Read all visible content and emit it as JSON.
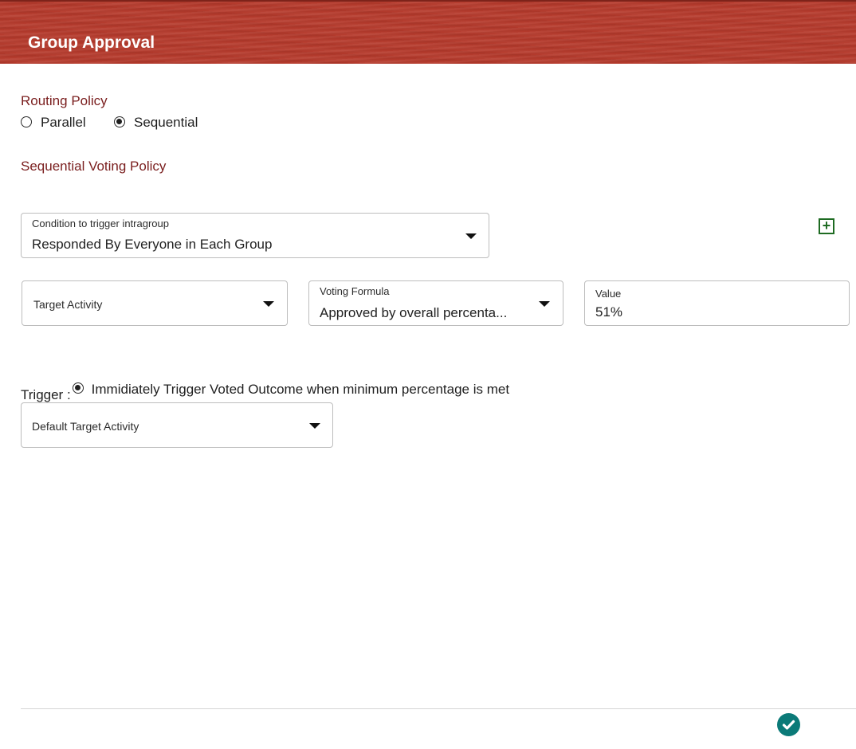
{
  "header": {
    "title": "Group Approval"
  },
  "routing_policy": {
    "label": "Routing Policy",
    "options": [
      {
        "label": "Parallel",
        "selected": false
      },
      {
        "label": "Sequential",
        "selected": true
      }
    ]
  },
  "voting_policy": {
    "label": "Sequential Voting Policy"
  },
  "condition": {
    "label": "Condition to trigger intragroup",
    "value": "Responded By Everyone in Each Group"
  },
  "add_button": {
    "icon": "plus-square-icon",
    "color": "#1e6b22"
  },
  "target_activity": {
    "placeholder": "Target Activity"
  },
  "voting_formula": {
    "label": "Voting Formula",
    "value": "Approved by overall percenta..."
  },
  "value_field": {
    "label": "Value",
    "value": "51%"
  },
  "trigger": {
    "label": "Trigger :",
    "option_label": "Immidiately Trigger Voted Outcome when minimum percentage is met",
    "selected": true
  },
  "default_target": {
    "placeholder": "Default Target Activity"
  },
  "footer": {
    "confirm_icon": "check-circle-icon",
    "confirm_color": "#0b7a78"
  },
  "colors": {
    "header_bg": "#b53a2c",
    "section_label": "#7a1e1e"
  }
}
